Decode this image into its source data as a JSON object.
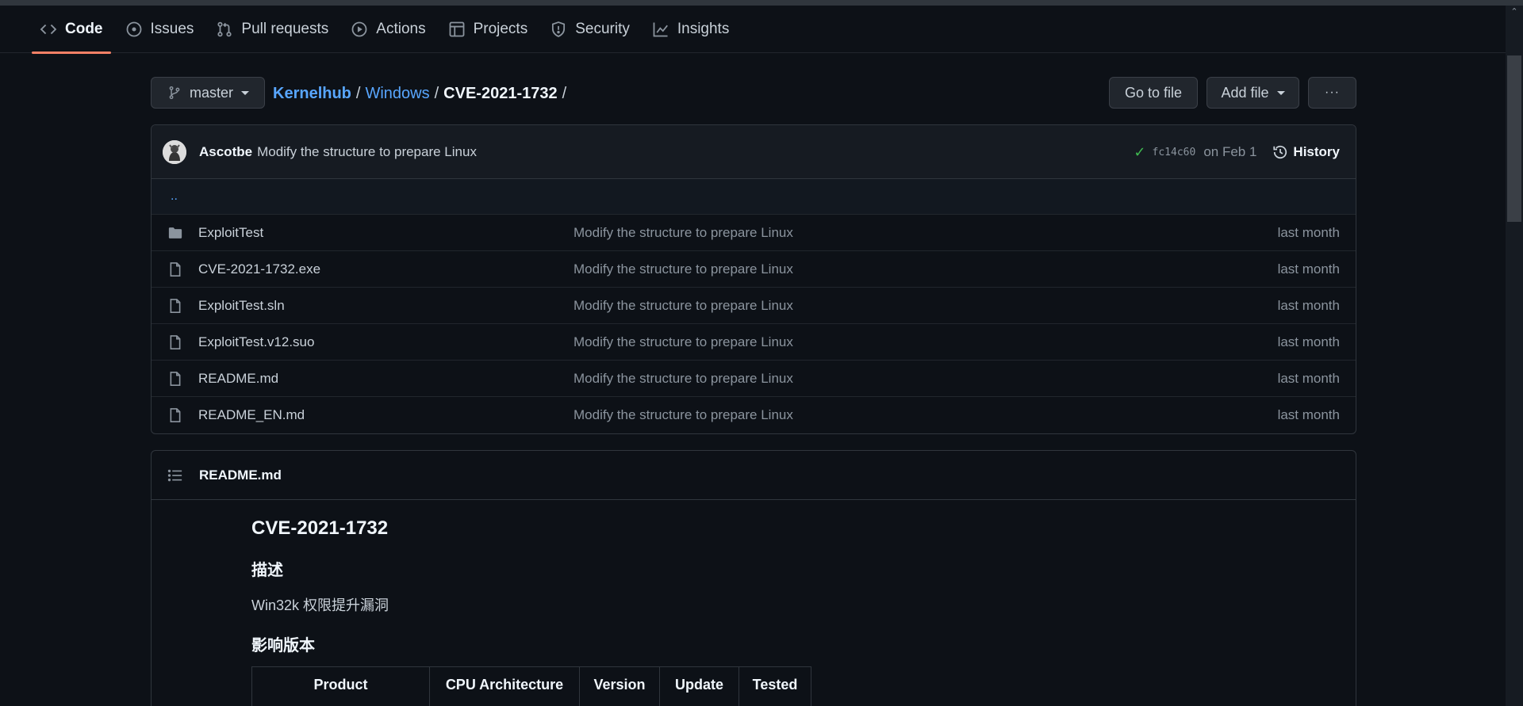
{
  "repo_nav": {
    "tabs": [
      {
        "label": "Code",
        "icon": "code-icon",
        "active": true
      },
      {
        "label": "Issues",
        "icon": "issue-icon"
      },
      {
        "label": "Pull requests",
        "icon": "pull-request-icon"
      },
      {
        "label": "Actions",
        "icon": "play-icon"
      },
      {
        "label": "Projects",
        "icon": "table-icon"
      },
      {
        "label": "Security",
        "icon": "shield-icon"
      },
      {
        "label": "Insights",
        "icon": "graph-icon"
      }
    ]
  },
  "branch": {
    "label": "master"
  },
  "breadcrumb": {
    "owner": "Kernelhub",
    "folder": "Windows",
    "current": "CVE-2021-1732",
    "sep": "/"
  },
  "actions": {
    "goto_file": "Go to file",
    "add_file": "Add file",
    "more": "···"
  },
  "commit": {
    "author": "Ascotbe",
    "message": "Modify the structure to prepare Linux",
    "sha": "fc14c60",
    "date": "on Feb 1",
    "history_label": "History"
  },
  "parent_dir": "..",
  "files": [
    {
      "name": "ExploitTest",
      "type": "dir",
      "message": "Modify the structure to prepare Linux",
      "age": "last month"
    },
    {
      "name": "CVE-2021-1732.exe",
      "type": "file",
      "message": "Modify the structure to prepare Linux",
      "age": "last month"
    },
    {
      "name": "ExploitTest.sln",
      "type": "file",
      "message": "Modify the structure to prepare Linux",
      "age": "last month"
    },
    {
      "name": "ExploitTest.v12.suo",
      "type": "file",
      "message": "Modify the structure to prepare Linux",
      "age": "last month"
    },
    {
      "name": "README.md",
      "type": "file",
      "message": "Modify the structure to prepare Linux",
      "age": "last month"
    },
    {
      "name": "README_EN.md",
      "type": "file",
      "message": "Modify the structure to prepare Linux",
      "age": "last month"
    }
  ],
  "readme": {
    "file_title": "README.md",
    "h1": "CVE-2021-1732",
    "section1": "描述",
    "desc": "Win32k 权限提升漏洞",
    "section2": "影响版本",
    "table_headers": [
      "Product",
      "CPU Architecture",
      "Version",
      "Update",
      "Tested"
    ]
  },
  "colors": {
    "accent": "#f78166",
    "link": "#58a6ff",
    "success": "#3fb950",
    "bg": "#0d1117"
  }
}
